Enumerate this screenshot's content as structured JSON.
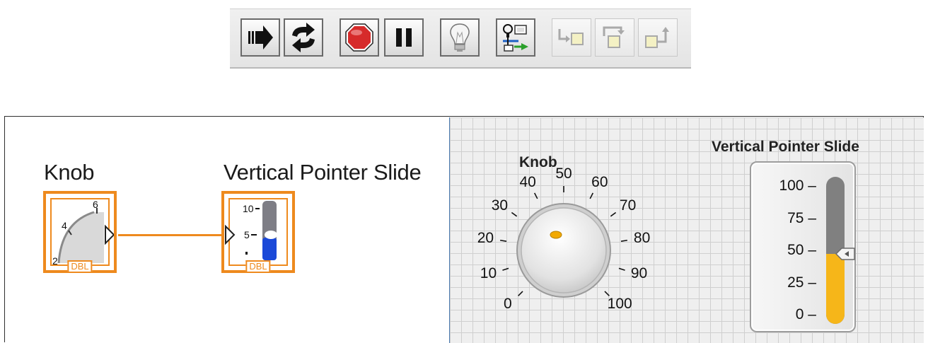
{
  "toolbar": {
    "buttons": [
      {
        "name": "run-icon"
      },
      {
        "name": "run-continuously-icon"
      },
      {
        "name": "abort-execution-icon"
      },
      {
        "name": "pause-icon"
      },
      {
        "name": "highlight-execution-icon"
      },
      {
        "name": "retain-wire-values-icon"
      },
      {
        "name": "step-into-icon"
      },
      {
        "name": "step-over-icon"
      },
      {
        "name": "step-out-icon"
      }
    ]
  },
  "block_diagram": {
    "knob": {
      "label": "Knob",
      "type_badge": "DBL",
      "icon_ticks": [
        "2",
        "4",
        "6"
      ]
    },
    "slide": {
      "label": "Vertical Pointer Slide",
      "type_badge": "DBL",
      "icon_ticks": [
        "10",
        "5"
      ]
    }
  },
  "front_panel": {
    "knob": {
      "label": "Knob",
      "scale": [
        "0",
        "10",
        "20",
        "30",
        "40",
        "50",
        "60",
        "70",
        "80",
        "90",
        "100"
      ],
      "value": 50
    },
    "slide": {
      "label": "Vertical Pointer Slide",
      "scale": [
        "0",
        "25",
        "50",
        "75",
        "100"
      ],
      "value": 47,
      "range": [
        0,
        100
      ]
    }
  },
  "colors": {
    "terminal": "#ee8a1e",
    "slide_fill": "#f6b619",
    "slide_track": "#808080",
    "abort": "#d62b2b"
  }
}
